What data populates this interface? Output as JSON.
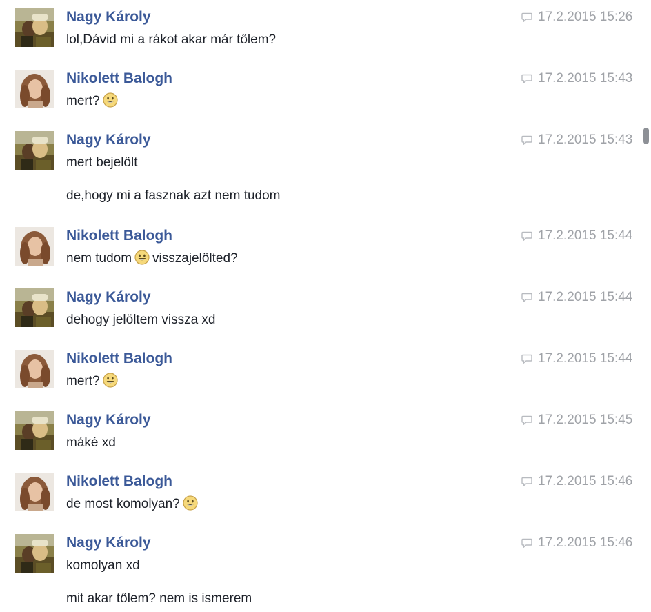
{
  "colors": {
    "sender_name": "#3b5998",
    "message_text": "#1d2129",
    "timestamp": "#a0a3a8",
    "scroll_thumb": "#8d9096"
  },
  "icons": {
    "timestamp": "speech-bubble-icon",
    "emoji": "smiley-emoji-icon"
  },
  "messages": [
    {
      "sender": "Nagy Károly",
      "timestamp": "17.2.2015 15:26",
      "line1": "lol,Dávid mi a rákot akar már tőlem?"
    },
    {
      "sender": "Nikolett Balogh",
      "timestamp": "17.2.2015 15:43",
      "line1": "mert?"
    },
    {
      "sender": "Nagy Károly",
      "timestamp": "17.2.2015 15:43",
      "line1": "mert bejelölt",
      "line2": "de,hogy mi a fasznak azt nem tudom"
    },
    {
      "sender": "Nikolett Balogh",
      "timestamp": "17.2.2015 15:44",
      "line1_a": "nem tudom",
      "line1_b": "visszajelölted?"
    },
    {
      "sender": "Nagy Károly",
      "timestamp": "17.2.2015 15:44",
      "line1": "dehogy jelöltem vissza xd"
    },
    {
      "sender": "Nikolett Balogh",
      "timestamp": "17.2.2015 15:44",
      "line1": "mert?"
    },
    {
      "sender": "Nagy Károly",
      "timestamp": "17.2.2015 15:45",
      "line1": "máké xd"
    },
    {
      "sender": "Nikolett Balogh",
      "timestamp": "17.2.2015 15:46",
      "line1": "de most komolyan?"
    },
    {
      "sender": "Nagy Károly",
      "timestamp": "17.2.2015 15:46",
      "line1": "komolyan xd",
      "line2": "mit akar tőlem? nem is ismerem"
    }
  ]
}
